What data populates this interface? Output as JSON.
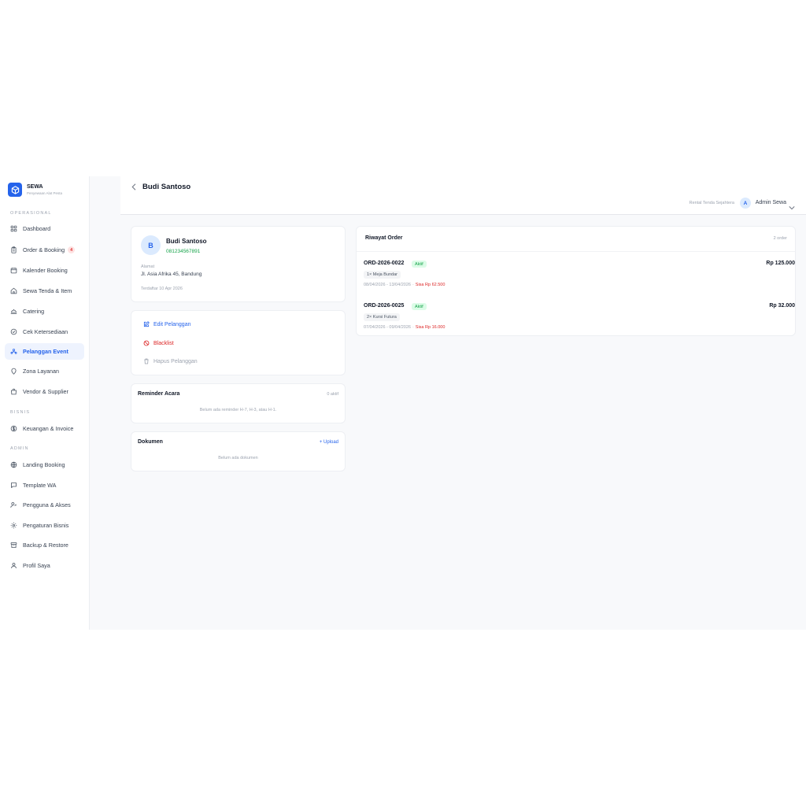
{
  "brand": {
    "name": "SEWA",
    "tagline": "Penyewaan Alat Pesta"
  },
  "sidebar": {
    "sections": [
      {
        "label": "OPERASIONAL"
      },
      {
        "label": "BISNIS"
      },
      {
        "label": "ADMIN"
      }
    ],
    "items": [
      {
        "label": "Dashboard",
        "icon": "grid-icon"
      },
      {
        "label": "Order & Booking",
        "icon": "clipboard-icon",
        "badge": "4"
      },
      {
        "label": "Kalender Booking",
        "icon": "calendar-icon"
      },
      {
        "label": "Sewa Tenda & Item",
        "icon": "tent-icon"
      },
      {
        "label": "Catering",
        "icon": "food-icon"
      },
      {
        "label": "Cek Ketersediaan",
        "icon": "check-circle-icon"
      },
      {
        "label": "Pelanggan Event",
        "icon": "users-icon"
      },
      {
        "label": "Zona Layanan",
        "icon": "map-pin-icon"
      },
      {
        "label": "Vendor & Supplier",
        "icon": "store-icon"
      },
      {
        "label": "Keuangan & Invoice",
        "icon": "dollar-icon"
      },
      {
        "label": "Landing Booking",
        "icon": "globe-icon"
      },
      {
        "label": "Template WA",
        "icon": "message-icon"
      },
      {
        "label": "Pengguna & Akses",
        "icon": "user-key-icon"
      },
      {
        "label": "Pengaturan Bisnis",
        "icon": "settings-icon"
      },
      {
        "label": "Backup & Restore",
        "icon": "archive-icon"
      },
      {
        "label": "Profil Saya",
        "icon": "user-icon"
      }
    ]
  },
  "header": {
    "title": "Budi Santoso",
    "business_name": "Rental Tenda Sejahtera",
    "user_initial": "A",
    "user_name": "Admin Sewa"
  },
  "customer": {
    "initial": "B",
    "name": "Budi Santoso",
    "phone": "081234567891",
    "address_label": "Alamat",
    "address": "Jl. Asia Afrika 45, Bandung",
    "registered": "Terdaftar 10 Apr 2026"
  },
  "actions": {
    "edit": "Edit Pelanggan",
    "blacklist": "Blacklist",
    "delete": "Hapus Pelanggan"
  },
  "reminder": {
    "title": "Reminder Acara",
    "count": "0 aktif",
    "empty": "Belum ada reminder H-7, H-3, atau H-1."
  },
  "documents": {
    "title": "Dokumen",
    "upload": "+ Upload",
    "empty": "Belum ada dokumen"
  },
  "orders": {
    "title": "Riwayat Order",
    "count": "2 order",
    "list": [
      {
        "id": "ORD-2026-0022",
        "status": "Aktif",
        "item": "1× Meja Bundar",
        "dates": "08/04/2026 - 13/04/2026",
        "remaining": "Sisa Rp 62.500",
        "price": "Rp 125.000"
      },
      {
        "id": "ORD-2026-0025",
        "status": "Aktif",
        "item": "2× Kursi Futura",
        "dates": "07/04/2026 - 09/04/2026",
        "remaining": "Sisa Rp 16.000",
        "price": "Rp 32.000"
      }
    ]
  },
  "colors": {
    "accent": "#2563eb",
    "success": "#16a34a",
    "danger": "#dc2626",
    "background": "#f8f9fb"
  }
}
